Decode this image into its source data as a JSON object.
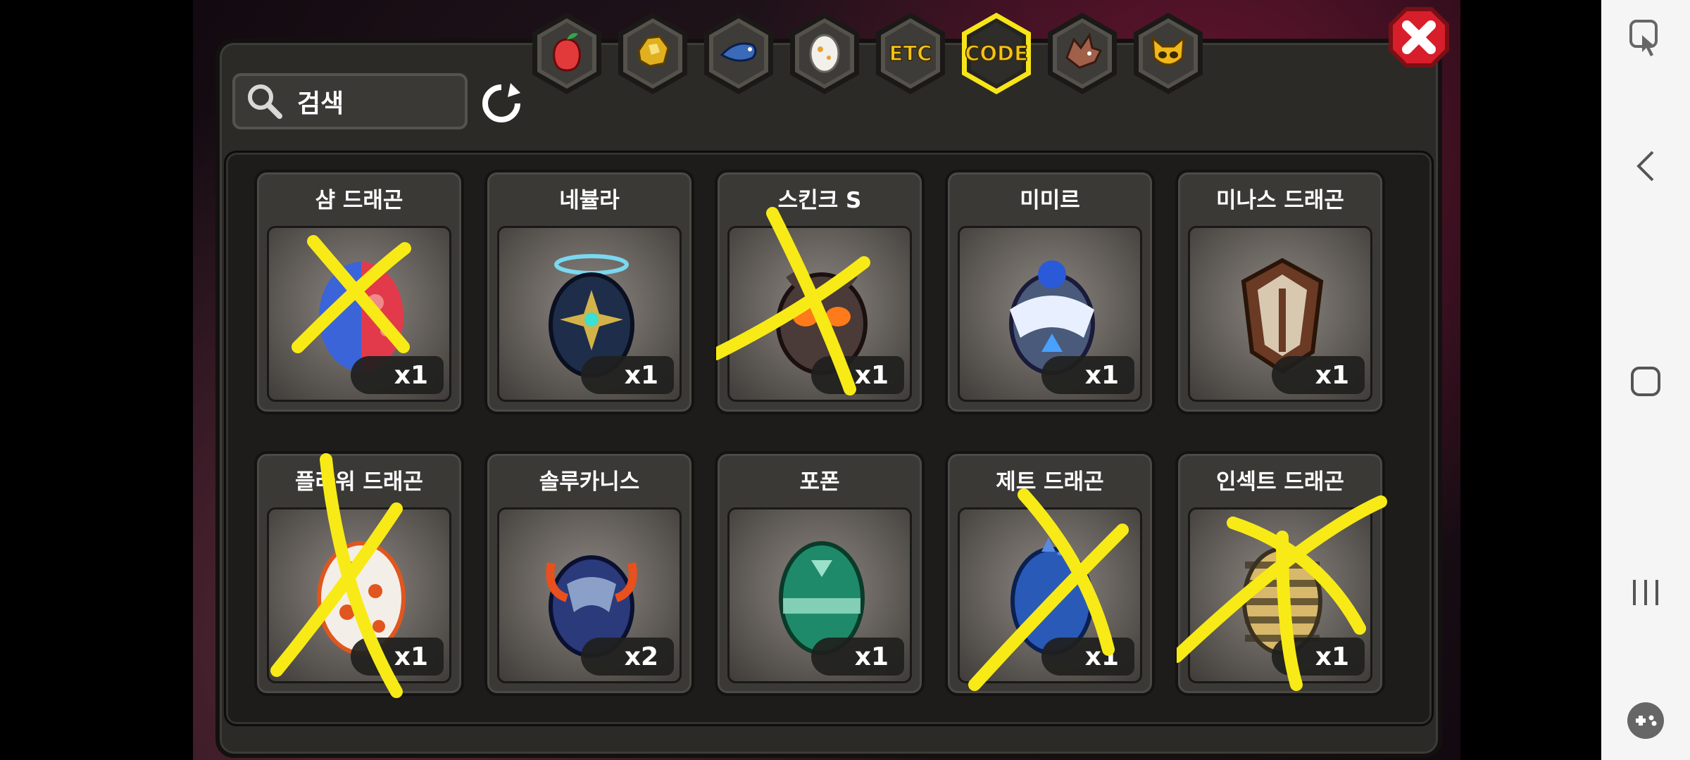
{
  "search": {
    "label": "검색"
  },
  "tabs": [
    {
      "id": "fruit",
      "text": "",
      "icon": "fruit-icon"
    },
    {
      "id": "gold",
      "text": "",
      "icon": "gold-nugget-icon"
    },
    {
      "id": "fish",
      "text": "",
      "icon": "fish-icon"
    },
    {
      "id": "egg",
      "text": "",
      "icon": "egg-icon"
    },
    {
      "id": "etc",
      "text": "ETC",
      "icon": ""
    },
    {
      "id": "code",
      "text": "CODE",
      "icon": "",
      "selected": true
    },
    {
      "id": "dragon",
      "text": "",
      "icon": "dragon-head-icon"
    },
    {
      "id": "mask",
      "text": "",
      "icon": "mask-icon"
    }
  ],
  "items": [
    {
      "name": "샴 드래곤",
      "count": "x1",
      "crossed": true,
      "colors": [
        "#3a64d8",
        "#e23a4a"
      ]
    },
    {
      "name": "네뷸라",
      "count": "x1",
      "crossed": false,
      "colors": [
        "#1d2d4a",
        "#d4b24a"
      ]
    },
    {
      "name": "스킨크 S",
      "count": "x1",
      "crossed": true,
      "colors": [
        "#4a3a38",
        "#ff7a1a"
      ]
    },
    {
      "name": "미미르",
      "count": "x1",
      "crossed": false,
      "colors": [
        "#2a5ad8",
        "#e8f0ff"
      ]
    },
    {
      "name": "미나스 드래곤",
      "count": "x1",
      "crossed": false,
      "colors": [
        "#6a3a24",
        "#d8c8b0"
      ]
    },
    {
      "name": "플라워 드래곤",
      "count": "x1",
      "crossed": true,
      "colors": [
        "#f4eee8",
        "#e0561e"
      ]
    },
    {
      "name": "솔루카니스",
      "count": "x2",
      "crossed": false,
      "colors": [
        "#2a3a7a",
        "#e8501e"
      ]
    },
    {
      "name": "포폰",
      "count": "x1",
      "crossed": false,
      "colors": [
        "#1f8a6a",
        "#9be0c8"
      ]
    },
    {
      "name": "제트 드래곤",
      "count": "x1",
      "crossed": true,
      "colors": [
        "#2a5ab8",
        "#5a8ae0"
      ]
    },
    {
      "name": "인섹트 드래곤",
      "count": "x1",
      "crossed": true,
      "colors": [
        "#d8b86a",
        "#3a3020"
      ]
    }
  ],
  "colors": {
    "scribble": "#f8ea16",
    "tab_gold": "#f3c316",
    "close_red": "#d81e2a"
  }
}
